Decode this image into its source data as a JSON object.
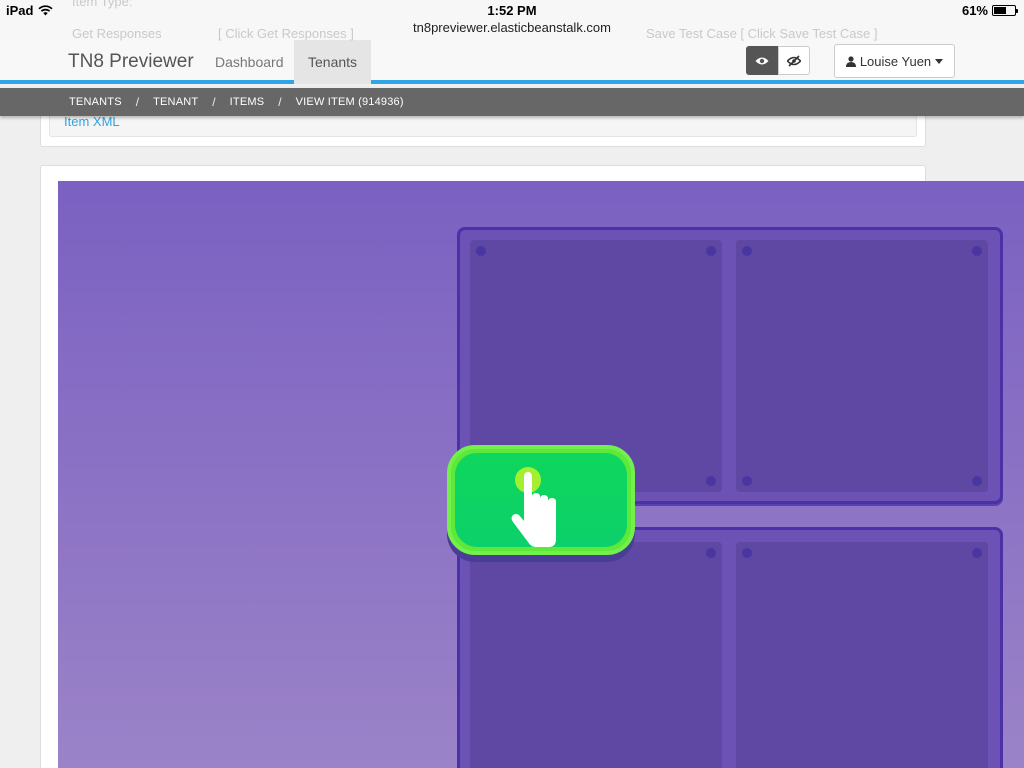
{
  "status_bar": {
    "device": "iPad",
    "time": "1:52 PM",
    "url": "tn8previewer.elasticbeanstalk.com",
    "battery": "61%",
    "battery_level": 0.61
  },
  "ghost_text": {
    "line1": "Item Type:",
    "line2_left": "Get Responses",
    "line2_mid": "[ Click Get Responses ]",
    "line2_right": "Save Test Case   [ Click Save Test Case ]"
  },
  "navbar": {
    "brand": "TN8 Previewer",
    "links": [
      "Dashboard",
      "Tenants"
    ],
    "active_link": "Tenants",
    "user_name": "Louise Yuen"
  },
  "breadcrumb": [
    "TENANTS",
    "TENANT",
    "ITEMS",
    "VIEW ITEM (914936)"
  ],
  "item_xml_link": "Item XML",
  "colors": {
    "accent": "#2fa4e7",
    "stage_top": "#7a61c2",
    "board": "#6b52b4",
    "drag_button": "#0fd65c"
  }
}
